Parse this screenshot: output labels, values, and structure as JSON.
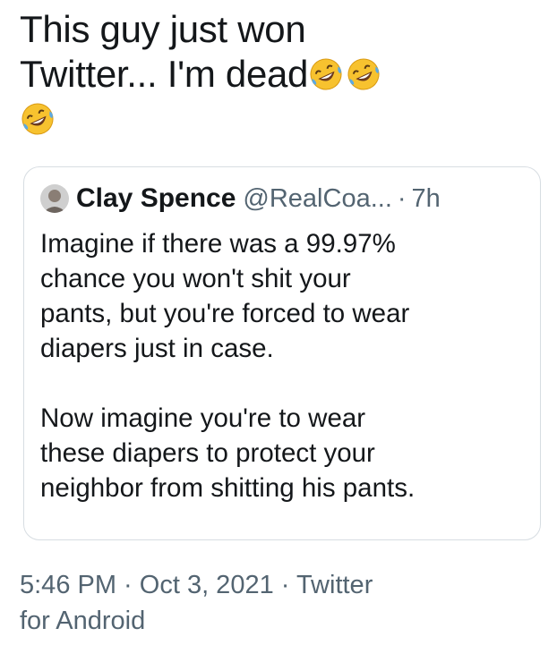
{
  "tweet": {
    "text_line_1": "This guy just won",
    "text_line_2": "Twitter... I'm dead",
    "emoji_name": "rolling-on-floor-laughing",
    "emoji_count": 3
  },
  "quote": {
    "author_name": "Clay Spence",
    "author_handle": "@RealCoa...",
    "separator": "·",
    "time": "7h",
    "paragraph_1": [
      "Imagine if there was a 99.97%",
      "chance you won't shit your",
      "pants, but you're forced to wear",
      "diapers just in case."
    ],
    "paragraph_2": [
      "Now imagine you're to wear",
      "these diapers to protect your",
      "neighbor from shitting his pants."
    ]
  },
  "meta": {
    "line_1": "5:46 PM · Oct 3, 2021 · Twitter",
    "line_2": "for Android"
  },
  "colors": {
    "text_primary": "#14171a",
    "text_secondary": "#536471",
    "card_border": "#d7dde2",
    "emoji_face": "#f7c22f",
    "emoji_tears": "#5aa9e6"
  }
}
